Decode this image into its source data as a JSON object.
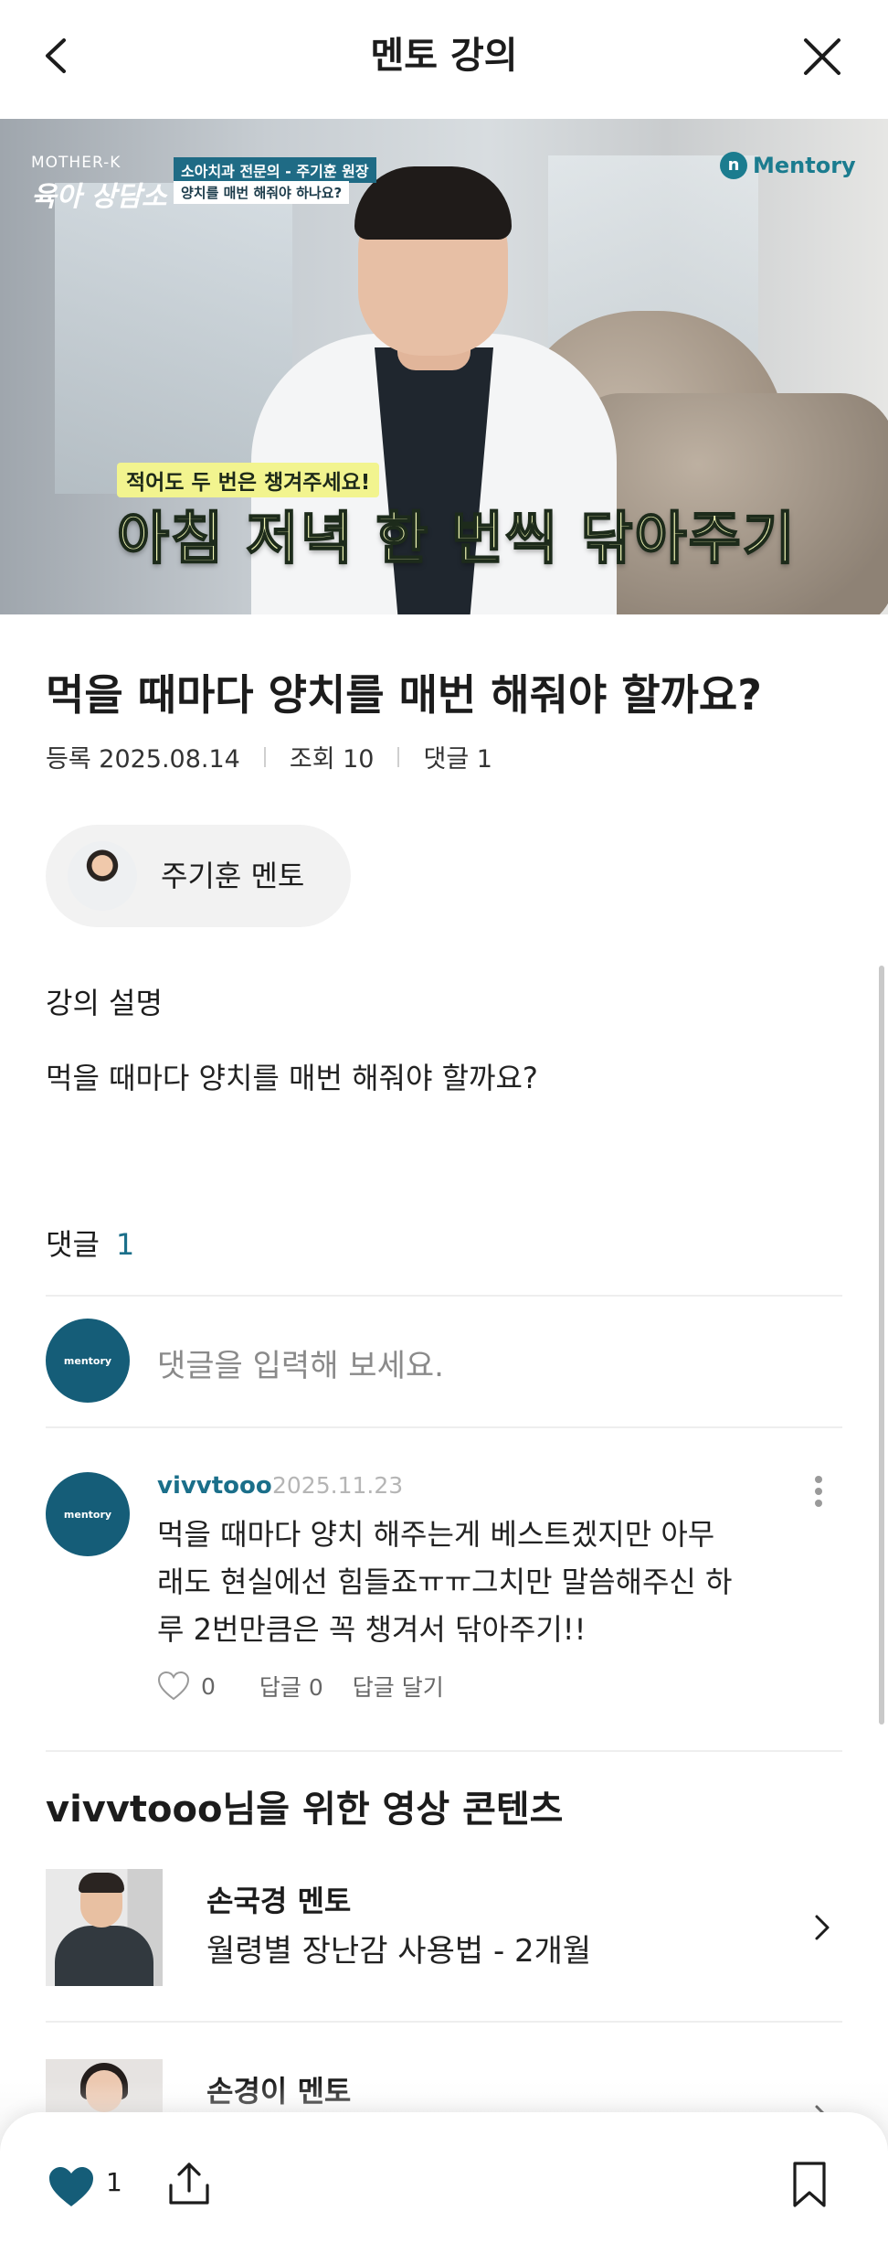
{
  "header": {
    "title": "멘토 강의",
    "back_icon": "chevron-left-icon",
    "close_icon": "close-icon"
  },
  "video": {
    "brand_small": "MOTHER-K",
    "brand_main": "육아 상담소",
    "tag_line1": "소아치과 전문의 - 주기훈 원장",
    "tag_line2": "양치를 매번 해줘야 하나요?",
    "logo_text": "Mentory",
    "caption_small": "적어도 두 번은 챙겨주세요!",
    "caption_big": "아침 저녁 한 번씩 닦아주기"
  },
  "lecture": {
    "title": "먹을 때마다 양치를 매번 해줘야 할까요?",
    "registered": "등록 2025.08.14",
    "views": "조회 10",
    "comments": "댓글 1"
  },
  "mentor": {
    "name": "주기훈 멘토"
  },
  "description": {
    "label": "강의 설명",
    "text": "먹을 때마다 양치를 매번 해줘야 할까요?"
  },
  "comments": {
    "label": "댓글",
    "count": "1",
    "input_placeholder": "댓글을 입력해 보세요.",
    "items": [
      {
        "user": "vivvtooo",
        "date": "2025.11.23",
        "lines": [
          "먹을 때마다 양치 해주는게 베스트겠지만 아무",
          "래도 현실에선 힘들죠ㅠㅠ그치만 말씀해주신 하",
          "루 2번만큼은 꼭 챙겨서 닦아주기!!"
        ],
        "likes": "0",
        "replies": "답글 0",
        "reply_action": "답글 달기"
      }
    ]
  },
  "recommend": {
    "title": "vivvtooo님을 위한 영상 콘텐츠",
    "items": [
      {
        "mentor": "손국경 멘토",
        "subtitle": "월령별 장난감 사용법 - 2개월"
      },
      {
        "mentor": "손경이 멘토",
        "subtitle": ""
      }
    ]
  },
  "bottom_bar": {
    "like_count": "1",
    "like_icon": "heart-filled-icon",
    "share_icon": "share-icon",
    "bookmark_icon": "bookmark-icon"
  },
  "colors": {
    "accent": "#1b6f8a",
    "avatar_bg": "#155d78",
    "heart": "#155d78"
  }
}
